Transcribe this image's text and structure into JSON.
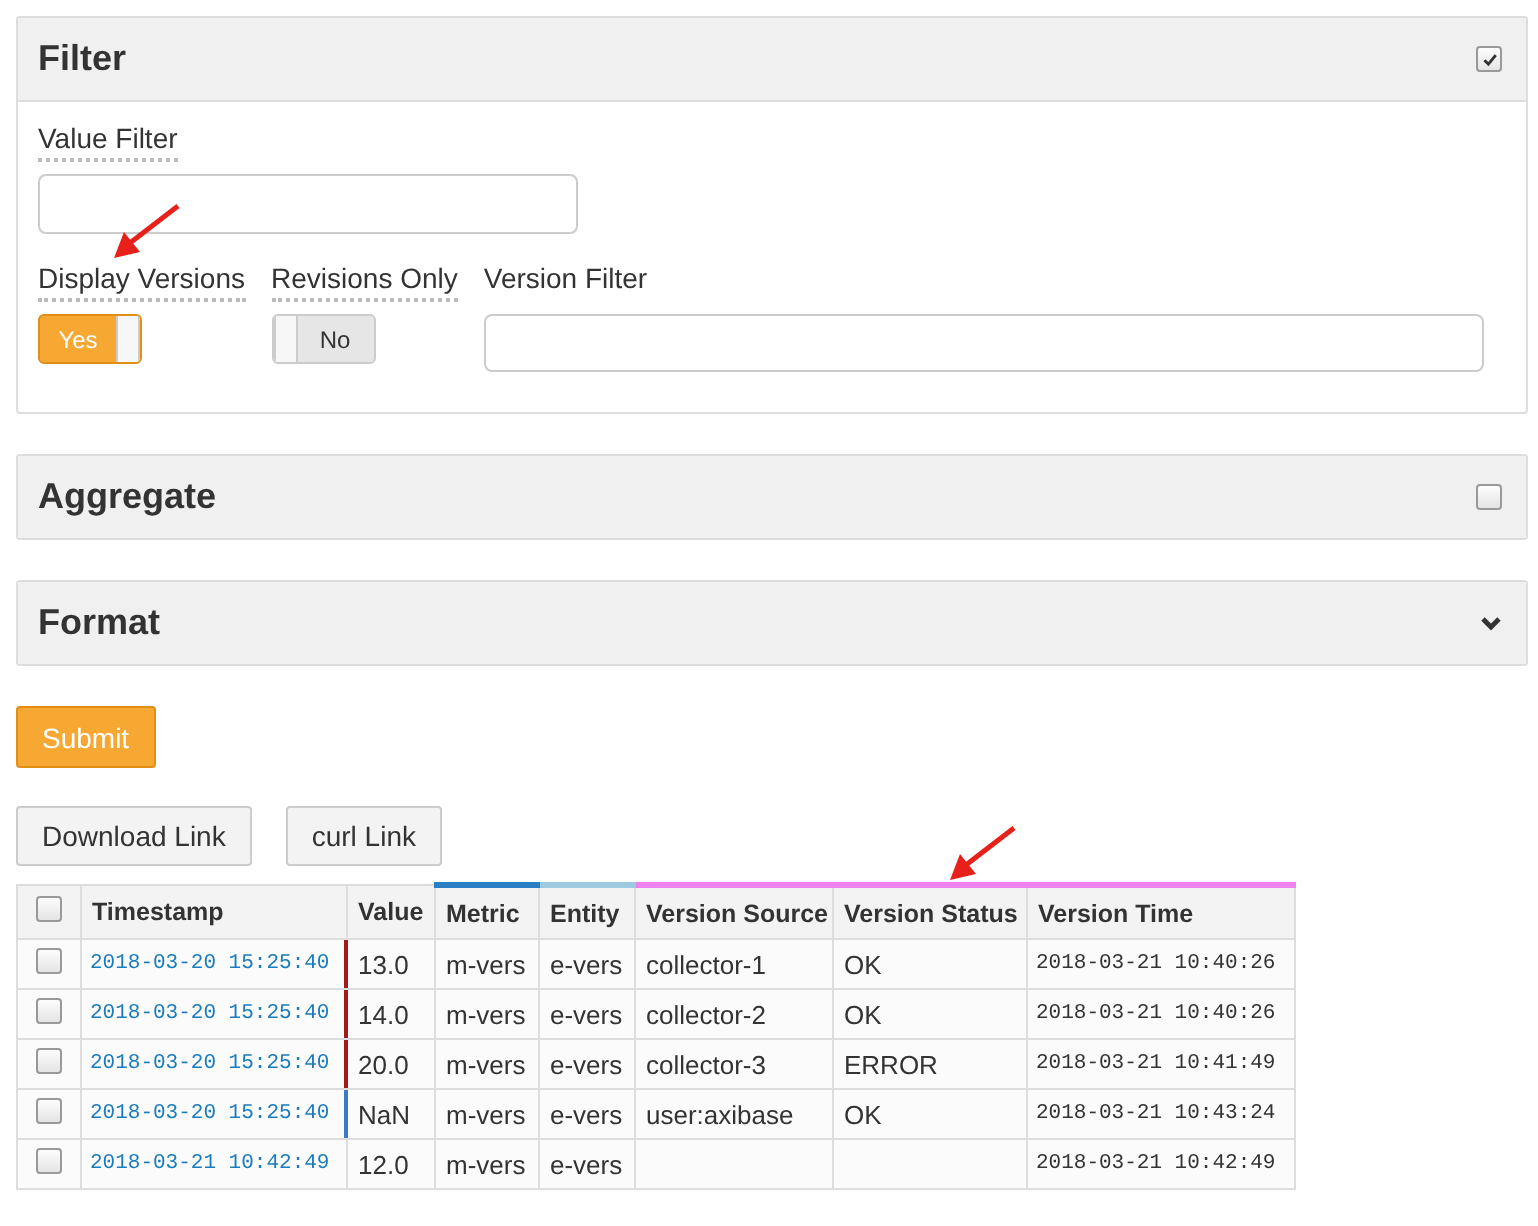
{
  "filter_panel": {
    "title": "Filter",
    "kind": "checkbox",
    "checked": true,
    "value_filter": {
      "label": "Value Filter"
    },
    "toggles": [
      {
        "label": "Display Versions",
        "on": true,
        "text": "Yes"
      },
      {
        "label": "Revisions Only",
        "on": false,
        "text": "No"
      }
    ],
    "version_filter": {
      "label": "Version Filter"
    }
  },
  "panels": [
    {
      "title": "Aggregate",
      "kind": "checkbox",
      "checked": false
    },
    {
      "title": "Format",
      "kind": "chevron"
    }
  ],
  "submit_button": "Submit",
  "link_buttons": [
    "Download Link",
    "curl Link"
  ],
  "table": {
    "columns": [
      {
        "label": "Timestamp"
      },
      {
        "label": "Value"
      },
      {
        "label": "Metric",
        "color": "#2a7fc4"
      },
      {
        "label": "Entity",
        "color": "#9ecae1"
      },
      {
        "label": "Version Source",
        "color": "#ee82ee"
      },
      {
        "label": "Version Status",
        "color": "#ee82ee"
      },
      {
        "label": "Version Time",
        "color": "#ee82ee"
      }
    ],
    "header_checked": false,
    "rows": [
      {
        "checked": false,
        "color": "#a01c1c",
        "cells": [
          "2018-03-20 15:25:40",
          "13.0",
          "m-vers",
          "e-vers",
          "collector-1",
          "OK",
          "2018-03-21 10:40:26"
        ]
      },
      {
        "checked": false,
        "color": "#a01c1c",
        "cells": [
          "2018-03-20 15:25:40",
          "14.0",
          "m-vers",
          "e-vers",
          "collector-2",
          "OK",
          "2018-03-21 10:40:26"
        ]
      },
      {
        "checked": false,
        "color": "#a01c1c",
        "cells": [
          "2018-03-20 15:25:40",
          "20.0",
          "m-vers",
          "e-vers",
          "collector-3",
          "ERROR",
          "2018-03-21 10:41:49"
        ]
      },
      {
        "checked": false,
        "color": "#3a7cc4",
        "cells": [
          "2018-03-20 15:25:40",
          "NaN",
          "m-vers",
          "e-vers",
          "user:axibase",
          "OK",
          "2018-03-21 10:43:24"
        ]
      },
      {
        "checked": false,
        "cells": [
          "2018-03-21 10:42:49",
          "12.0",
          "m-vers",
          "e-vers",
          "",
          "",
          "2018-03-21 10:42:49"
        ]
      }
    ]
  }
}
